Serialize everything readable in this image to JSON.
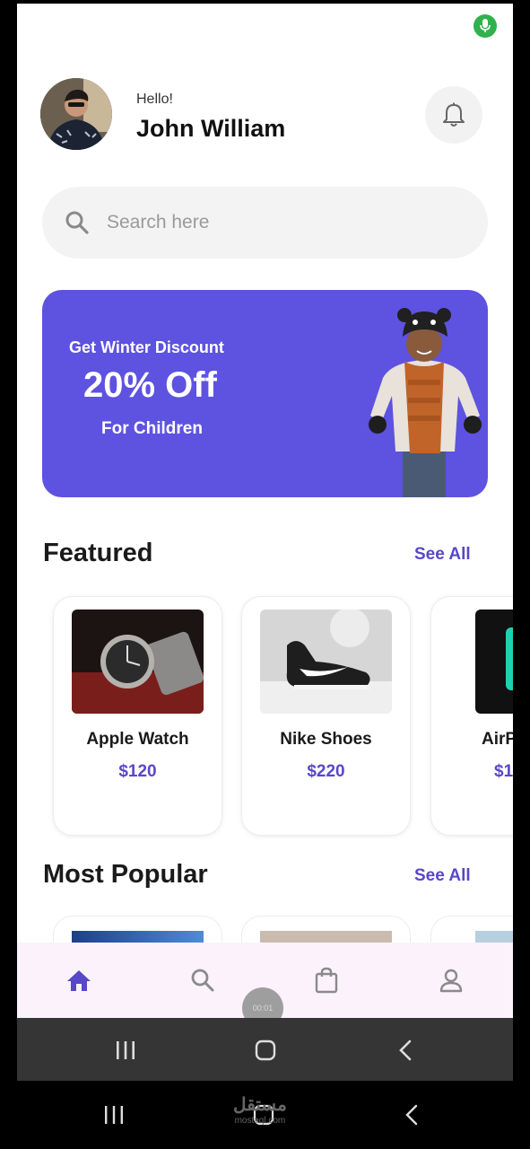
{
  "header": {
    "greeting": "Hello!",
    "user_name": "John William"
  },
  "search": {
    "placeholder": "Search here"
  },
  "promo": {
    "line1": "Get Winter Discount",
    "line2": "20% Off",
    "line3": "For Children",
    "background_color": "#5e52e0"
  },
  "featured": {
    "title": "Featured",
    "see_all": "See All",
    "products": [
      {
        "name": "Apple Watch",
        "price": "$120"
      },
      {
        "name": "Nike Shoes",
        "price": "$220"
      },
      {
        "name": "AirP",
        "price": "$1"
      }
    ]
  },
  "most_popular": {
    "title": "Most Popular",
    "see_all": "See All"
  },
  "bottom_nav": {
    "items": [
      "home-icon",
      "search-icon",
      "shopping-bag-icon",
      "profile-icon"
    ],
    "active": "home-icon",
    "active_color": "#5748c8"
  },
  "recording": {
    "timer": "00:01"
  },
  "watermark": {
    "text": "مستقل",
    "subtext": "mostaql.com"
  },
  "colors": {
    "accent": "#5748c8",
    "mic_indicator": "#2fb24c"
  }
}
